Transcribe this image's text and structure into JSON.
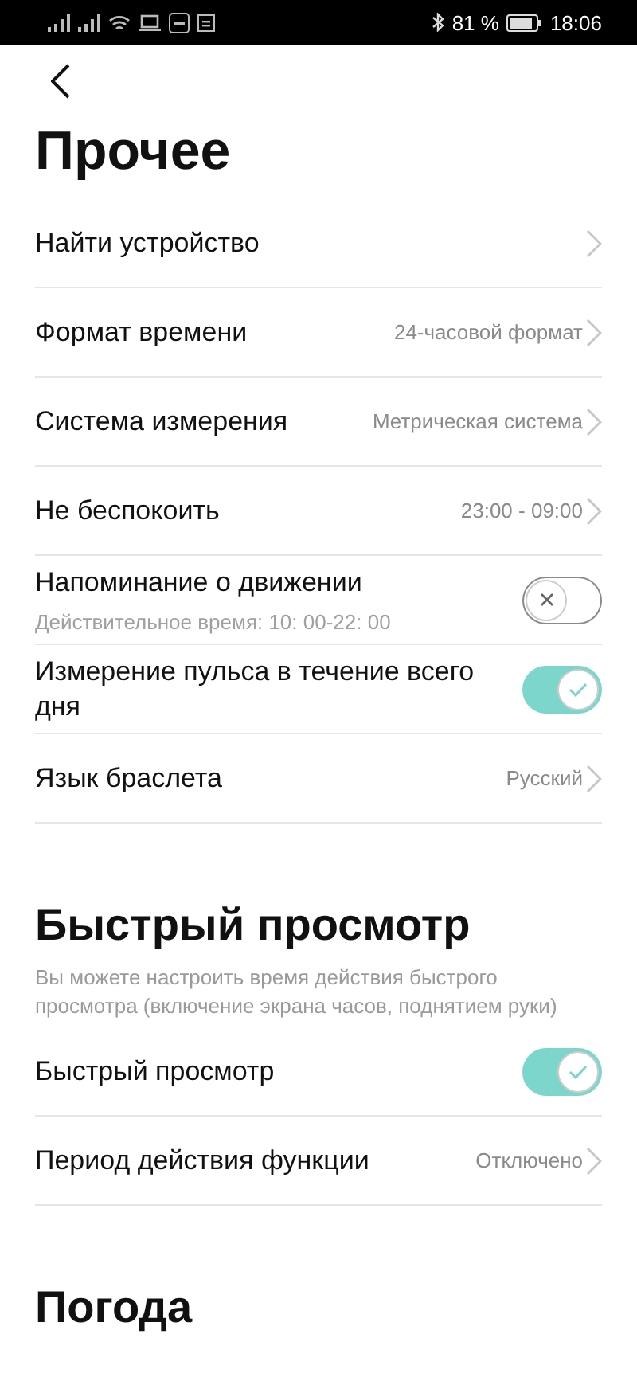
{
  "status_bar": {
    "battery": "81 %",
    "time": "18:06"
  },
  "title": "Прочее",
  "sections": [
    {
      "rows": [
        {
          "kind": "link",
          "label": "Найти устройство"
        },
        {
          "kind": "link",
          "label": "Формат времени",
          "value": "24-часовой формат"
        },
        {
          "kind": "link",
          "label": "Система измерения",
          "value": "Метрическая система"
        },
        {
          "kind": "link",
          "label": "Не беспокоить",
          "value": "23:00 - 09:00"
        },
        {
          "kind": "toggle",
          "label": "Напоминание о движении",
          "note": "Действительное время: 10: 00-22: 00",
          "on": false
        },
        {
          "kind": "toggle",
          "label": "Измерение пульса в течение всего дня",
          "on": true
        },
        {
          "kind": "link",
          "label": "Язык браслета",
          "value": "Русский"
        }
      ]
    },
    {
      "heading": "Быстрый просмотр",
      "description": "Вы можете настроить время действия быстрого просмотра (включение экрана часов, поднятием руки)",
      "rows": [
        {
          "kind": "toggle",
          "label": "Быстрый просмотр",
          "on": true
        },
        {
          "kind": "link",
          "label": "Период действия функции",
          "value": "Отключено"
        }
      ]
    },
    {
      "heading": "Погода"
    }
  ]
}
